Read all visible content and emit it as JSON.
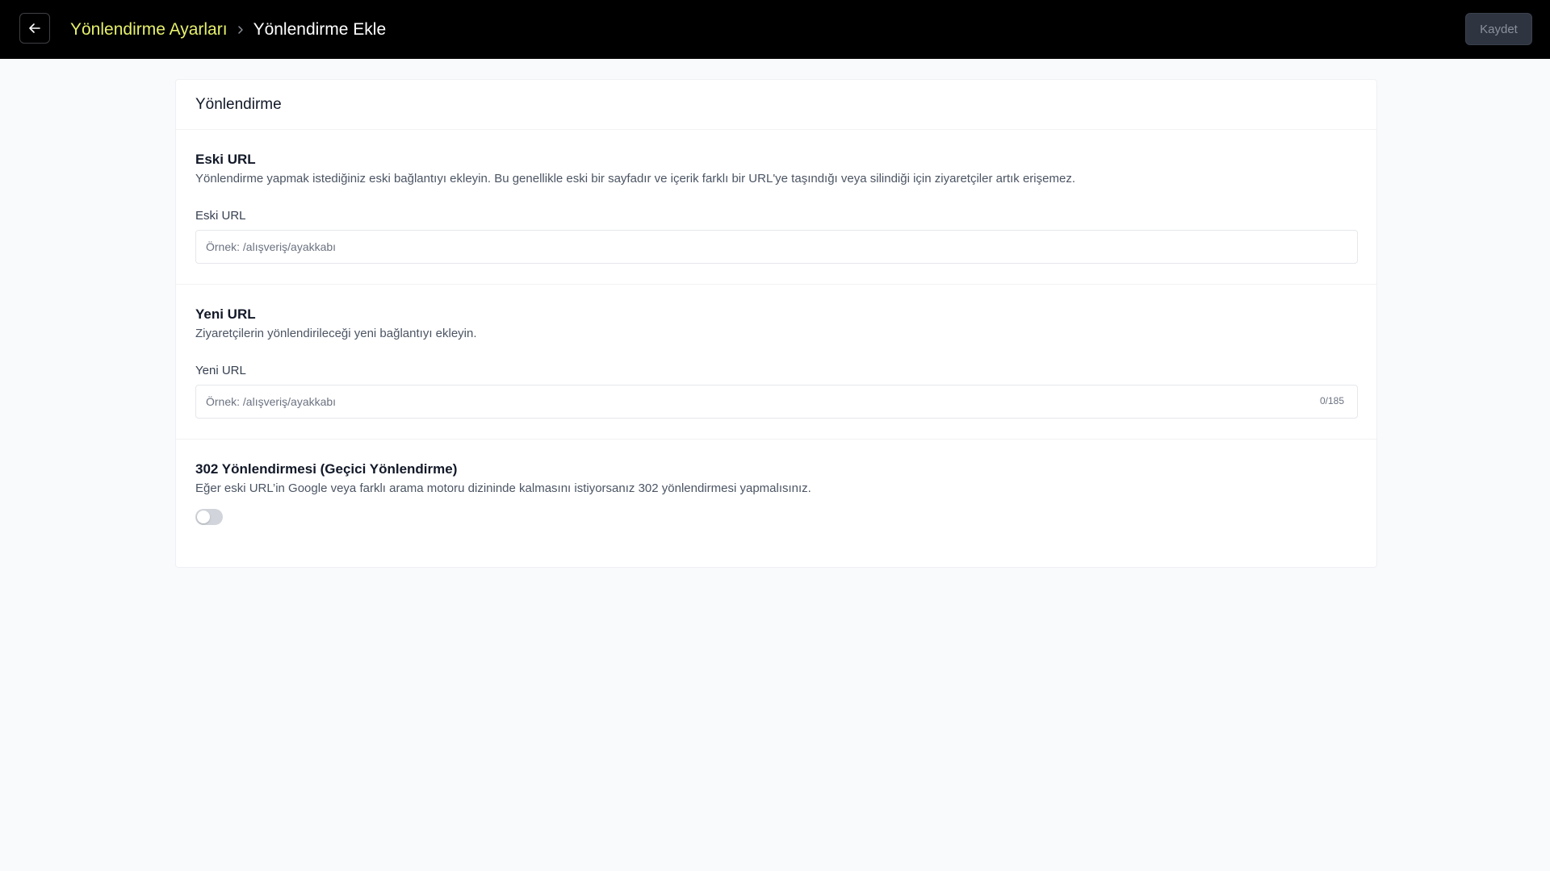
{
  "header": {
    "breadcrumb_parent": "Yönlendirme Ayarları",
    "breadcrumb_current": "Yönlendirme Ekle",
    "save_label": "Kaydet",
    "back_icon": "arrow-left-icon",
    "separator_icon": "chevron-right-icon",
    "accent_color": "#e6f06b"
  },
  "card": {
    "title": "Yönlendirme"
  },
  "old_url": {
    "title": "Eski URL",
    "description": "Yönlendirme yapmak istediğiniz eski bağlantıyı ekleyin. Bu genellikle eski bir sayfadır ve içerik farklı bir URL'ye taşındığı veya silindiği için ziyaretçiler artık erişemez.",
    "label": "Eski URL",
    "placeholder": "Örnek: /alışveriş/ayakkabı",
    "value": ""
  },
  "new_url": {
    "title": "Yeni URL",
    "description": "Ziyaretçilerin yönlendirileceği yeni bağlantıyı ekleyin.",
    "label": "Yeni URL",
    "placeholder": "Örnek: /alışveriş/ayakkabı",
    "value": "",
    "counter": "0/185"
  },
  "redirect_302": {
    "title": "302 Yönlendirmesi (Geçici Yönlendirme)",
    "description": "Eğer eski URL’in Google veya farklı arama motoru dizininde kalmasını istiyorsanız 302 yönlendirmesi yapmalısınız.",
    "enabled": false
  }
}
